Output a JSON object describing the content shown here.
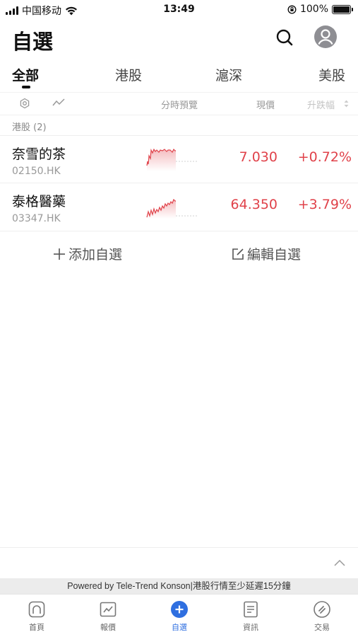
{
  "status_bar": {
    "carrier": "中国移动",
    "time": "13:49",
    "battery": "100%"
  },
  "header": {
    "title": "自選"
  },
  "tabs": [
    {
      "label": "全部",
      "active": true
    },
    {
      "label": "港股",
      "active": false
    },
    {
      "label": "滬深",
      "active": false
    },
    {
      "label": "美股",
      "active": false
    }
  ],
  "columns": {
    "intraday": "分時預覽",
    "price": "現價",
    "change": "升跌幅"
  },
  "section": {
    "label": "港股 (2)"
  },
  "stocks": [
    {
      "name": "奈雪的茶",
      "code": "02150.HK",
      "price": "7.030",
      "change": "+0.72%"
    },
    {
      "name": "泰格醫藥",
      "code": "03347.HK",
      "price": "64.350",
      "change": "+3.79%"
    }
  ],
  "actions": {
    "add": "添加自選",
    "edit": "編輯自選"
  },
  "footer": {
    "powered_by": "Powered by Tele-Trend Konson|港股行情至少延遲15分鐘"
  },
  "bottom_nav": [
    {
      "label": "首頁",
      "icon": "home-icon"
    },
    {
      "label": "報價",
      "icon": "quote-chart-icon"
    },
    {
      "label": "自選",
      "icon": "watchlist-plus-icon",
      "active": true
    },
    {
      "label": "資訊",
      "icon": "news-document-icon"
    },
    {
      "label": "交易",
      "icon": "trade-icon"
    }
  ],
  "colors": {
    "up_red": "#e0424a",
    "active_blue": "#2f6fe0"
  }
}
